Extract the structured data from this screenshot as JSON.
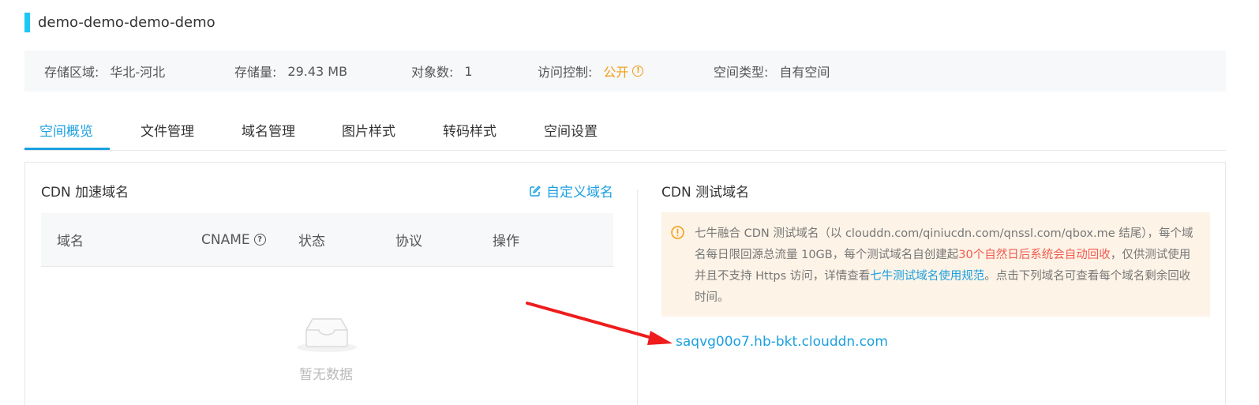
{
  "bucket": {
    "name": "demo-demo-demo-demo"
  },
  "info": {
    "region_label": "存储区域:",
    "region_value": "华北-河北",
    "storage_label": "存储量:",
    "storage_value": "29.43 MB",
    "objects_label": "对象数:",
    "objects_value": "1",
    "access_label": "访问控制:",
    "access_value": "公开",
    "type_label": "空间类型:",
    "type_value": "自有空间"
  },
  "tabs": [
    {
      "label": "空间概览",
      "active": true
    },
    {
      "label": "文件管理",
      "active": false
    },
    {
      "label": "域名管理",
      "active": false
    },
    {
      "label": "图片样式",
      "active": false
    },
    {
      "label": "转码样式",
      "active": false
    },
    {
      "label": "空间设置",
      "active": false
    }
  ],
  "cdn": {
    "title": "CDN 加速域名",
    "custom_domain_label": "自定义域名",
    "columns": [
      "域名",
      "CNAME",
      "状态",
      "协议",
      "操作"
    ],
    "empty_text": "暂无数据"
  },
  "test": {
    "title": "CDN 测试域名",
    "notice_part1": "七牛融合 CDN 测试域名（以 clouddn.com/qiniucdn.com/qnssl.com/qbox.me 结尾），每个域名每日限回源总流量 10GB，每个测试域名自创建起",
    "notice_red": "30个自然日后系统会自动回收",
    "notice_part2": "，仅供测试使用并且不支持 Https 访问，详情查看",
    "notice_link": "七牛测试域名使用规范",
    "notice_part3": "。点击下列域名可查看每个域名剩余回收时间。",
    "domain": "saqvg00o7.hb-bkt.clouddn.com"
  },
  "colors": {
    "accent": "#1ba0e1",
    "title_bar": "#1ec8f5",
    "warning": "#f39c12",
    "danger": "#f25a4e",
    "arrow": "#ee1c1c"
  }
}
